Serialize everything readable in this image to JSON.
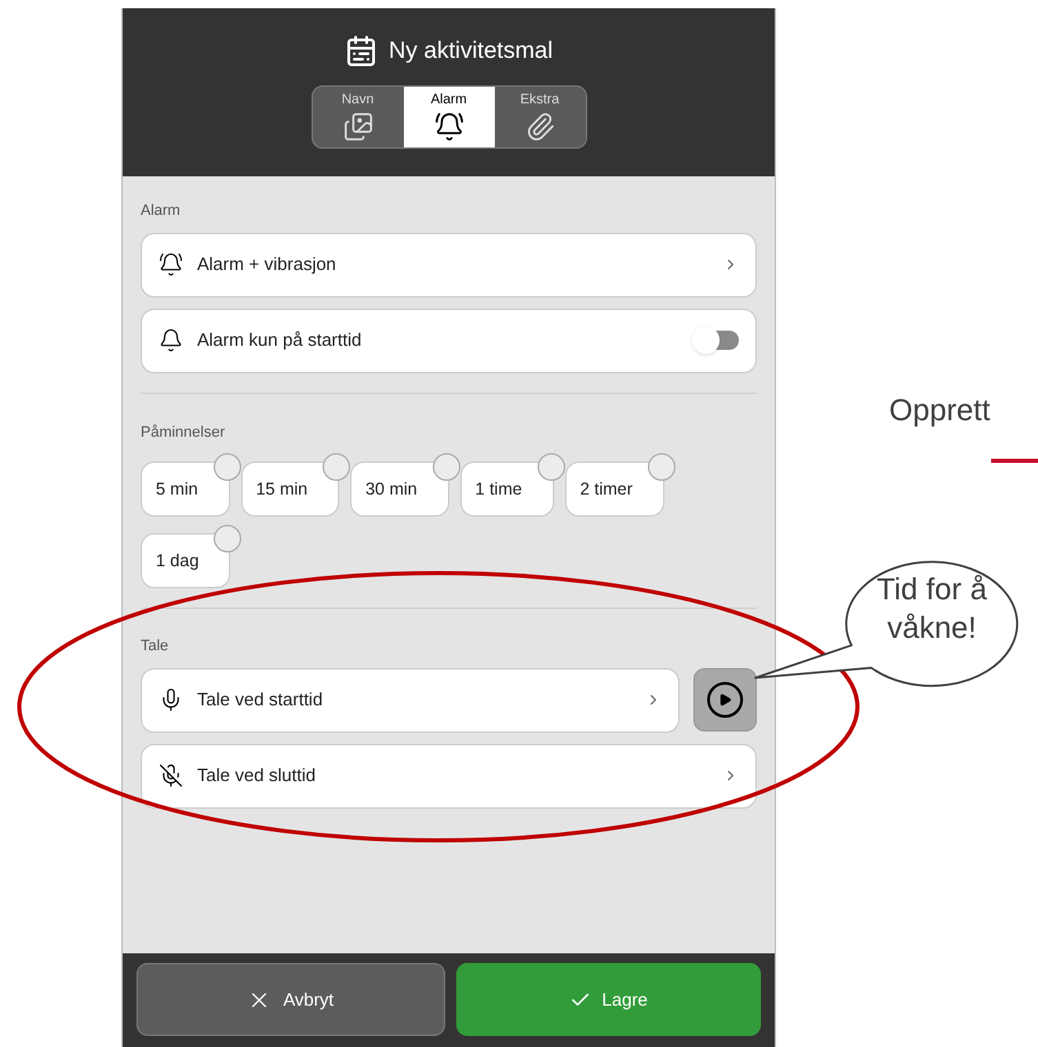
{
  "slide": {
    "heading": "Opprett",
    "callout": "Tid for å våkne!"
  },
  "header": {
    "title": "Ny aktivitetsmal"
  },
  "tabs": [
    {
      "label": "Navn",
      "selected": false
    },
    {
      "label": "Alarm",
      "selected": true
    },
    {
      "label": "Ekstra",
      "selected": false
    }
  ],
  "alarm": {
    "title": "Alarm",
    "items": [
      {
        "kind": "link",
        "label": "Alarm + vibrasjon"
      },
      {
        "kind": "toggle",
        "label": "Alarm kun på starttid",
        "on": false
      }
    ]
  },
  "reminders": {
    "title": "Påminnelser",
    "chips": [
      {
        "label": "5 min",
        "checked": false
      },
      {
        "label": "15 min",
        "checked": false
      },
      {
        "label": "30 min",
        "checked": false
      },
      {
        "label": "1 time",
        "checked": false
      },
      {
        "label": "2 timer",
        "checked": false
      },
      {
        "label": "1 dag",
        "checked": false
      }
    ]
  },
  "speech": {
    "title": "Tale",
    "items": [
      {
        "label": "Tale ved starttid",
        "play": true
      },
      {
        "label": "Tale ved sluttid",
        "play": false
      }
    ]
  },
  "footer": [
    {
      "kind": "cancel",
      "label": "Avbryt"
    },
    {
      "kind": "confirm",
      "label": "Lagre"
    }
  ]
}
